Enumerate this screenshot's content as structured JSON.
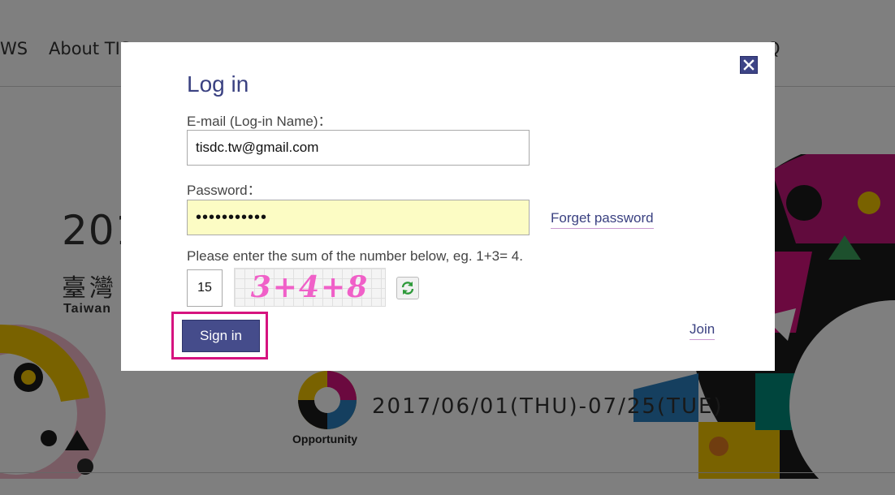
{
  "background": {
    "nav": [
      "WS",
      "About TIS",
      "Q"
    ],
    "hero_year": "201",
    "hero_zh": "臺灣",
    "hero_en": "Taiwan",
    "dates": "2017/06/01(THU)-07/25(TUE)",
    "logo_label": "Opportunity"
  },
  "modal": {
    "title": "Log in",
    "email_label": "E-mail (Log-in Name)：",
    "email_value": "tisdc.tw@gmail.com",
    "password_label": "Password：",
    "password_value": "•••••••••••",
    "forget_label": "Forget password",
    "captcha_prompt": "Please enter the sum of the number below, eg. 1+3= 4.",
    "captcha_answer": "15",
    "captcha_text": "3+4+8",
    "signin_label": "Sign in",
    "join_label": "Join",
    "close_icon": "close-icon",
    "refresh_icon": "refresh-icon"
  },
  "colors": {
    "accent": "#3a4181",
    "highlight": "#d6137f",
    "captcha": "#f060c8",
    "password_bg": "#fcfcc4"
  }
}
